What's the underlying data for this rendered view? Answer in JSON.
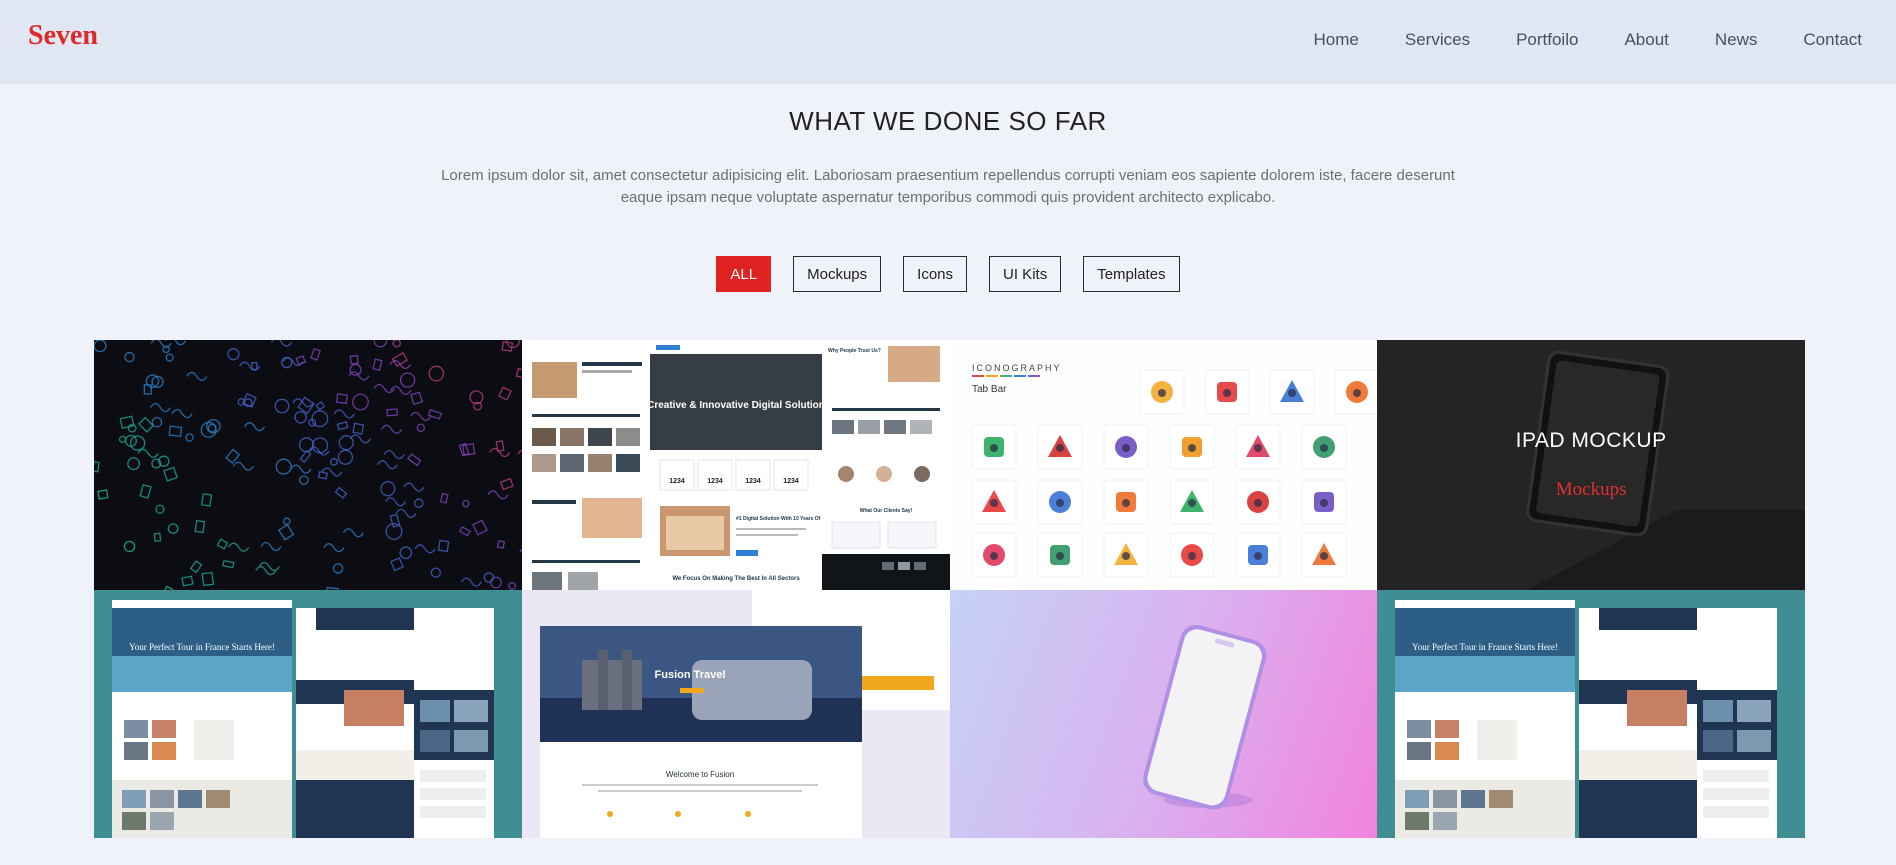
{
  "brand": "Seven",
  "nav": [
    "Home",
    "Services",
    "Portfoilo",
    "About",
    "News",
    "Contact"
  ],
  "section": {
    "title": "WHAT WE DONE SO FAR",
    "lead": "Lorem ipsum dolor sit, amet consectetur adipisicing elit. Laboriosam praesentium repellendus corrupti veniam eos sapiente dolorem iste, facere deserunt eaque ipsam neque voluptate aspernatur temporibus commodi quis provident architecto explicabo."
  },
  "filters": [
    "ALL",
    "Mockups",
    "Icons",
    "UI Kits",
    "Templates"
  ],
  "active_filter": "ALL",
  "portfolio": {
    "webs": {
      "headline": "Creative & Innovative Digital Solution",
      "stat": "1234",
      "feature": "#1 Digital Solution With 10 Years Of Experience",
      "focus": "We Focus On Making The Best In All Sectors",
      "trust": "Why People Trust Us?",
      "clients": "What Our Clients Say!"
    },
    "icons": {
      "eyebrow": "ICONOGRAPHY",
      "label": "Tab Bar"
    },
    "ipad": {
      "title": "IPAD MOCKUP",
      "category": "Mockups"
    },
    "travel": {
      "hero": "Your Perfect Tour in France Starts Here!"
    },
    "fusion": {
      "hero": "Fusion Travel",
      "welcome": "Welcome to Fusion"
    }
  },
  "colors": {
    "accent": "#e12222",
    "header_bg": "#e1e7f2",
    "page_bg": "#eff2f8"
  }
}
